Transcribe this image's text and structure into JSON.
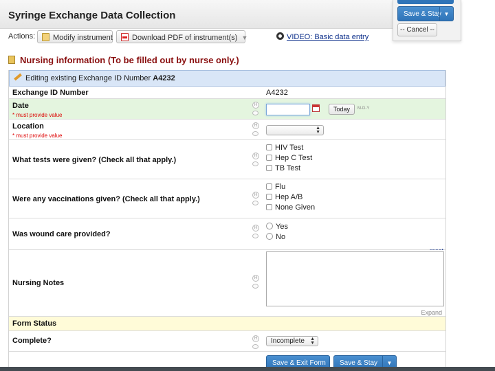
{
  "header": {
    "title": "Syringe Exchange Data Collection",
    "actions_label": "Actions:",
    "modify_label": "Modify instrument",
    "download_label": "Download PDF of instrument(s)",
    "video_label": "VIDEO: Basic data entry"
  },
  "float_panel": {
    "save_stay_label": "Save & Stay",
    "cancel_label": "-- Cancel --"
  },
  "section": {
    "title": "Nursing information (To be filled out by nurse only.)"
  },
  "editing": {
    "prefix": "Editing existing Exchange ID Number",
    "record_id": "A4232"
  },
  "fields": {
    "exchange_id": {
      "label": "Exchange ID Number",
      "value": "A4232"
    },
    "date": {
      "label": "Date",
      "required_note": "* must provide value",
      "today_label": "Today",
      "format_hint": "M-D-Y",
      "value": ""
    },
    "location": {
      "label": "Location",
      "required_note": "* must provide value",
      "selected": ""
    },
    "tests": {
      "label": "What tests were given? (Check all that apply.)",
      "options": [
        "HIV Test",
        "Hep C Test",
        "TB Test"
      ]
    },
    "vaccinations": {
      "label": "Were any vaccinations given? (Check all that apply.)",
      "options": [
        "Flu",
        "Hep A/B",
        "None Given"
      ]
    },
    "wound_care": {
      "label": "Was wound care provided?",
      "options": [
        "Yes",
        "No"
      ],
      "reset_label": "reset"
    },
    "notes": {
      "label": "Nursing Notes",
      "value": "",
      "expand_label": "Expand"
    },
    "form_status": {
      "label": "Form Status"
    },
    "complete": {
      "label": "Complete?",
      "selected": "Incomplete"
    }
  },
  "footer_buttons": {
    "save_exit_label": "Save & Exit Form",
    "save_stay_label": "Save & Stay"
  },
  "colors": {
    "required_row": "#e4f5df",
    "status_row": "#fffbd8",
    "editing_bar": "#d9e6f7",
    "primary_button": "#2f74b8",
    "section_title": "#8a1010"
  }
}
